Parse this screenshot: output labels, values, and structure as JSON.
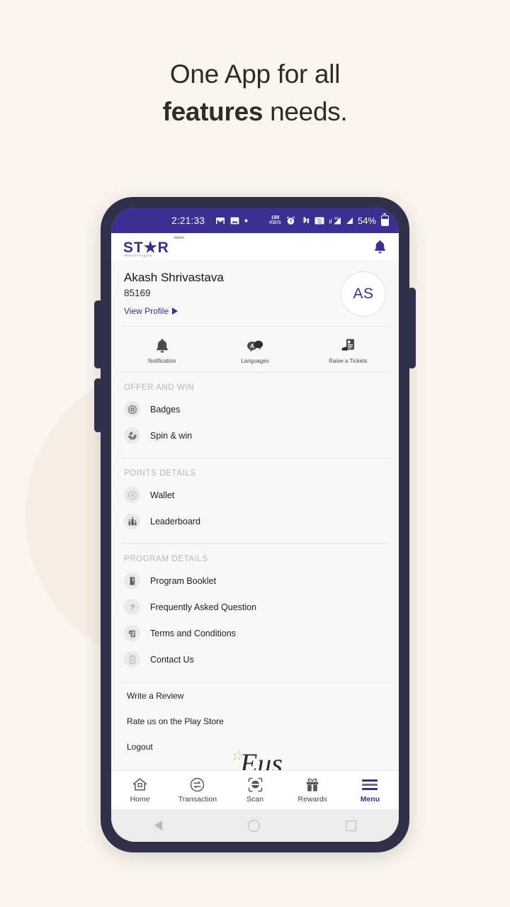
{
  "promo": {
    "line1": "One App for all",
    "line2_bold": "features",
    "line2_rest": " needs."
  },
  "colors": {
    "page_bg": "#faf5ef",
    "accent_indigo": "#3b2f91",
    "phone_frame": "#30304a",
    "status_bar": "#3b2f91",
    "gold": "#d9a93a"
  },
  "status_bar": {
    "clock": "2:21:33",
    "data_rate": "188",
    "data_unit": "KB/S",
    "battery_percent": "54%",
    "icons": [
      "gmail-icon",
      "photo-icon",
      "dot-icon",
      "data-rate-icon",
      "alarm-icon",
      "bluetooth-icon",
      "volte-icon",
      "signal-4g-icon",
      "signal-icon",
      "battery-icon"
    ]
  },
  "app_header": {
    "logo_word": "ST★R",
    "logo_top_text": "Abbott",
    "logo_sub_text": "Reward Program",
    "bell": "🔔"
  },
  "profile": {
    "name": "Akash Shrivastava",
    "id": "85169",
    "view_profile": "View Profile",
    "avatar_initials": "AS"
  },
  "quick_actions": [
    {
      "label": "Notification",
      "icon": "bell-icon"
    },
    {
      "label": "Languages",
      "icon": "languages-chat-icon"
    },
    {
      "label": "Raise a Tickets",
      "icon": "raise-ticket-icon"
    }
  ],
  "sections": [
    {
      "heading": "OFFER AND WIN",
      "items": [
        {
          "label": "Badges",
          "icon": "badge-icon"
        },
        {
          "label": "Spin & win",
          "icon": "spin-wheel-icon"
        }
      ]
    },
    {
      "heading": "POINTS DETAILS",
      "items": [
        {
          "label": "Wallet",
          "icon": "wallet-coin-icon"
        },
        {
          "label": "Leaderboard",
          "icon": "leaderboard-bars-icon"
        }
      ]
    },
    {
      "heading": "PROGRAM DETAILS",
      "items": [
        {
          "label": "Program Booklet",
          "icon": "booklet-icon"
        },
        {
          "label": "Frequently Asked Question",
          "icon": "question-mark-icon"
        },
        {
          "label": "Terms and Conditions",
          "icon": "terms-icon"
        },
        {
          "label": "Contact Us",
          "icon": "contact-clipboard-icon"
        }
      ]
    }
  ],
  "plain_links": [
    "Write a Review",
    "Rate us on the Play Store",
    "Logout"
  ],
  "watermark": {
    "text": "Eus",
    "star": "☆"
  },
  "bottom_nav": [
    {
      "label": "Home",
      "icon": "home-icon",
      "active": false
    },
    {
      "label": "Transaction",
      "icon": "transaction-icon",
      "active": false
    },
    {
      "label": "Scan",
      "icon": "scan-icon",
      "active": false
    },
    {
      "label": "Rewards",
      "icon": "gift-icon",
      "active": false
    },
    {
      "label": "Menu",
      "icon": "hamburger-menu-icon",
      "active": true
    }
  ],
  "android_nav": [
    "back-button",
    "home-button",
    "recents-button"
  ]
}
